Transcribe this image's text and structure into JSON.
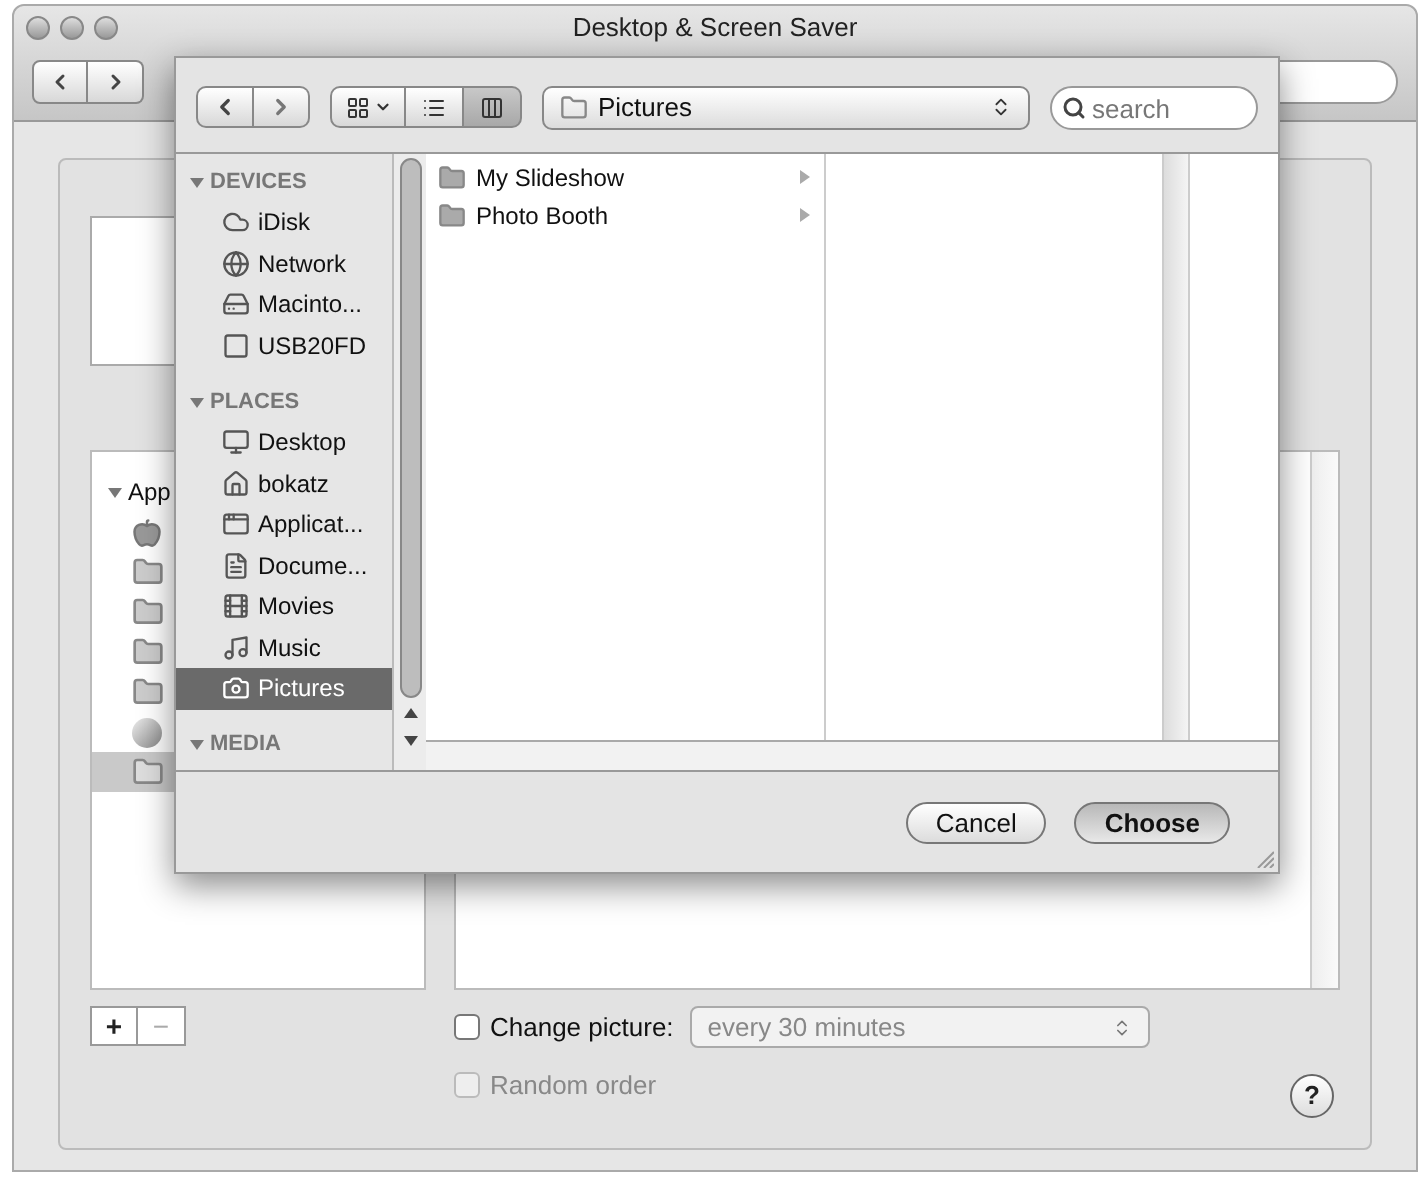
{
  "window": {
    "title": "Desktop & Screen Saver"
  },
  "folder_list": {
    "header": "App",
    "expanded": true
  },
  "add_remove": [
    "+",
    "−"
  ],
  "change_picture": {
    "label": "Change picture:",
    "checked": false,
    "interval": "every 30 minutes"
  },
  "random_order": {
    "label": "Random order",
    "checked": false,
    "disabled": true
  },
  "help": "?",
  "sheet": {
    "view_modes": [
      {
        "kind": "icon",
        "selected": false
      },
      {
        "kind": "list",
        "selected": false
      },
      {
        "kind": "column",
        "selected": true
      }
    ],
    "path": "Pictures",
    "search_placeholder": "search",
    "sidebar": [
      {
        "heading": "DEVICES",
        "expanded": true,
        "items": [
          {
            "kind": "idisk",
            "label": "iDisk",
            "selected": false
          },
          {
            "kind": "network",
            "label": "Network",
            "selected": false
          },
          {
            "kind": "drive",
            "label": "Macinto...",
            "selected": false
          },
          {
            "kind": "usb",
            "label": "USB20FD",
            "selected": false
          }
        ]
      },
      {
        "heading": "PLACES",
        "expanded": true,
        "items": [
          {
            "kind": "desktop",
            "label": "Desktop",
            "selected": false
          },
          {
            "kind": "home",
            "label": "bokatz",
            "selected": false
          },
          {
            "kind": "apps",
            "label": "Applicat...",
            "selected": false
          },
          {
            "kind": "docs",
            "label": "Docume...",
            "selected": false
          },
          {
            "kind": "movies",
            "label": "Movies",
            "selected": false
          },
          {
            "kind": "music",
            "label": "Music",
            "selected": false
          },
          {
            "kind": "pictures",
            "label": "Pictures",
            "selected": true
          }
        ]
      },
      {
        "heading": "MEDIA",
        "expanded": true
      }
    ],
    "column_1": [
      {
        "label": "My Slideshow"
      },
      {
        "label": "Photo Booth"
      }
    ],
    "buttons": [
      {
        "label": "Cancel",
        "default": false
      },
      {
        "label": "Choose",
        "default": true
      }
    ]
  }
}
